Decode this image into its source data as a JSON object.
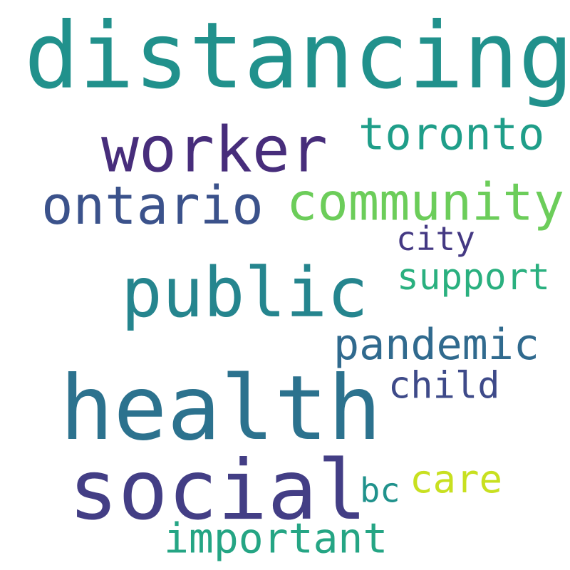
{
  "words": [
    {
      "text": "distancing",
      "color": "#21918c"
    },
    {
      "text": "health",
      "color": "#2c728e"
    },
    {
      "text": "social",
      "color": "#433e85"
    },
    {
      "text": "public",
      "color": "#25858e"
    },
    {
      "text": "worker",
      "color": "#472d7b"
    },
    {
      "text": "ontario",
      "color": "#3b528b"
    },
    {
      "text": "community",
      "color": "#6ccd5a"
    },
    {
      "text": "toronto",
      "color": "#1f9e89"
    },
    {
      "text": "pandemic",
      "color": "#306a8e"
    },
    {
      "text": "important",
      "color": "#25a584"
    },
    {
      "text": "support",
      "color": "#2ab07f"
    },
    {
      "text": "child",
      "color": "#3e4a89"
    },
    {
      "text": "care",
      "color": "#c8e020"
    },
    {
      "text": "city",
      "color": "#443983"
    },
    {
      "text": "bc",
      "color": "#20928c"
    }
  ]
}
